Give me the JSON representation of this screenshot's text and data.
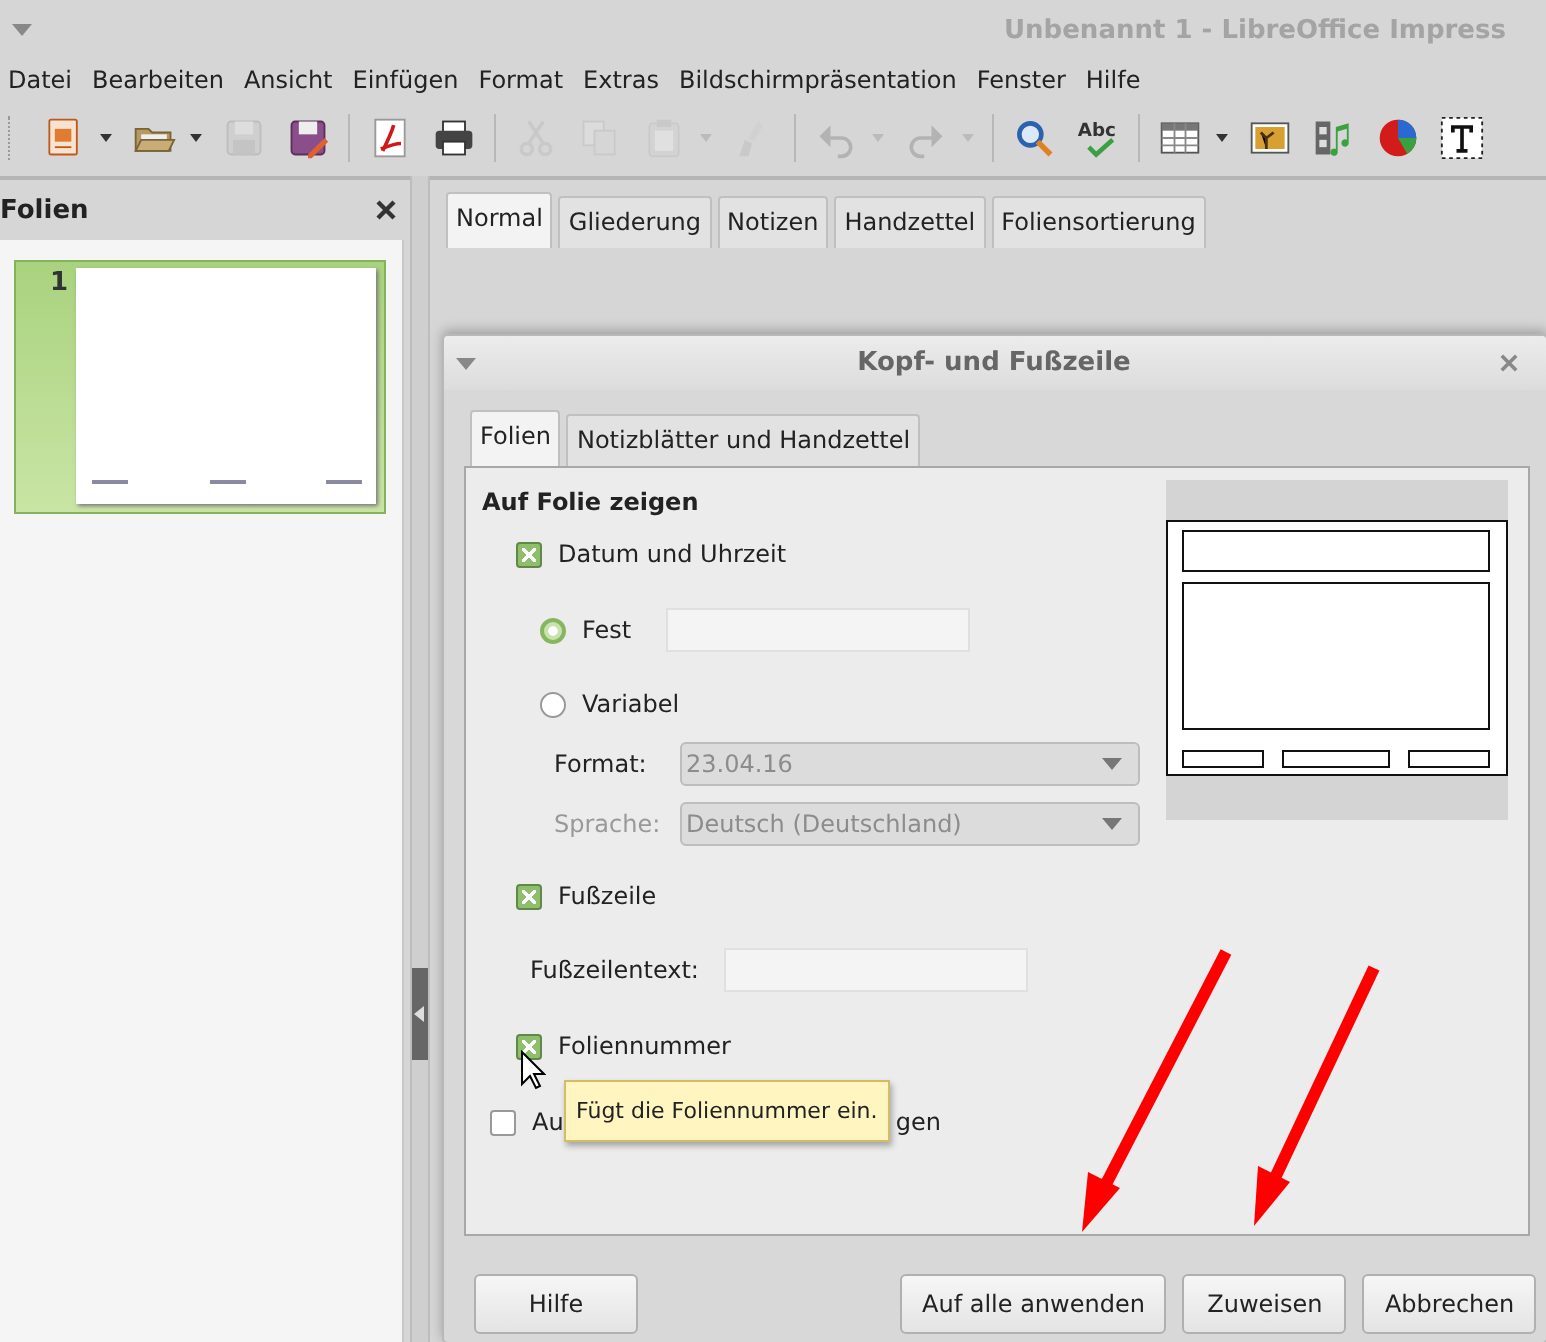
{
  "window": {
    "title": "Unbenannt 1 - LibreOffice Impress"
  },
  "menu": [
    "Datei",
    "Bearbeiten",
    "Ansicht",
    "Einfügen",
    "Format",
    "Extras",
    "Bildschirmpräsentation",
    "Fenster",
    "Hilfe"
  ],
  "toolbar": [
    [
      {
        "kind": "new",
        "disabled": false,
        "dropdown": true
      },
      {
        "kind": "open",
        "disabled": false,
        "dropdown": true
      },
      {
        "kind": "save",
        "disabled": true,
        "dropdown": false
      },
      {
        "kind": "saveas",
        "disabled": false,
        "dropdown": false
      }
    ],
    [
      {
        "kind": "pdf",
        "disabled": false,
        "dropdown": false
      },
      {
        "kind": "print",
        "disabled": false,
        "dropdown": false
      }
    ],
    [
      {
        "kind": "cut",
        "disabled": true,
        "dropdown": false
      },
      {
        "kind": "copy",
        "disabled": true,
        "dropdown": false
      },
      {
        "kind": "paste",
        "disabled": true,
        "dropdown": true
      },
      {
        "kind": "brush",
        "disabled": true,
        "dropdown": false
      }
    ],
    [
      {
        "kind": "undo",
        "disabled": true,
        "dropdown": true
      },
      {
        "kind": "redo",
        "disabled": true,
        "dropdown": true
      }
    ],
    [
      {
        "kind": "find",
        "disabled": false,
        "dropdown": false
      },
      {
        "kind": "spell",
        "disabled": false,
        "dropdown": false,
        "label": "Abc"
      }
    ],
    [
      {
        "kind": "table",
        "disabled": false,
        "dropdown": true
      },
      {
        "kind": "image",
        "disabled": false,
        "dropdown": false
      },
      {
        "kind": "media",
        "disabled": false,
        "dropdown": false
      },
      {
        "kind": "chart",
        "disabled": false,
        "dropdown": false
      },
      {
        "kind": "textbox",
        "disabled": false,
        "dropdown": false
      }
    ]
  ],
  "slide_panel": {
    "title": "Folien",
    "slides": [
      {
        "number": "1",
        "selected": true
      }
    ]
  },
  "view_tabs": [
    {
      "label": "Normal",
      "selected": true
    },
    {
      "label": "Gliederung",
      "selected": false
    },
    {
      "label": "Notizen",
      "selected": false
    },
    {
      "label": "Handzettel",
      "selected": false
    },
    {
      "label": "Foliensortierung",
      "selected": false
    }
  ],
  "dialog": {
    "title": "Kopf- und Fußzeile",
    "tabs": [
      {
        "label": "Folien",
        "selected": true
      },
      {
        "label": "Notizblätter und Handzettel",
        "selected": false
      }
    ],
    "section_title": "Auf Folie zeigen",
    "date_time": {
      "label": "Datum und Uhrzeit",
      "checked": true
    },
    "date_options": [
      {
        "label": "Fest",
        "selected": true
      },
      {
        "label": "Variabel",
        "selected": false
      }
    ],
    "format": {
      "label": "Format:",
      "value": "23.04.16",
      "disabled": true,
      "label_disabled": false
    },
    "language": {
      "label": "Sprache:",
      "value": "Deutsch (Deutschland)",
      "disabled": true,
      "label_disabled": true
    },
    "footer": {
      "label": "Fußzeile",
      "checked": true
    },
    "footer_text": {
      "label": "Fußzeilentext:"
    },
    "slide_number": {
      "label": "Foliennummer",
      "checked": true
    },
    "title_slide": {
      "label_start": "Au",
      "label_end": "gen",
      "checked": false
    },
    "tooltip": "Fügt die Foliennummer ein.",
    "buttons": [
      {
        "label": "Hilfe",
        "kind": "help"
      },
      {
        "label": "Auf alle anwenden",
        "kind": "action"
      },
      {
        "label": "Zuweisen",
        "kind": "action"
      },
      {
        "label": "Abbrechen",
        "kind": "action"
      }
    ]
  }
}
